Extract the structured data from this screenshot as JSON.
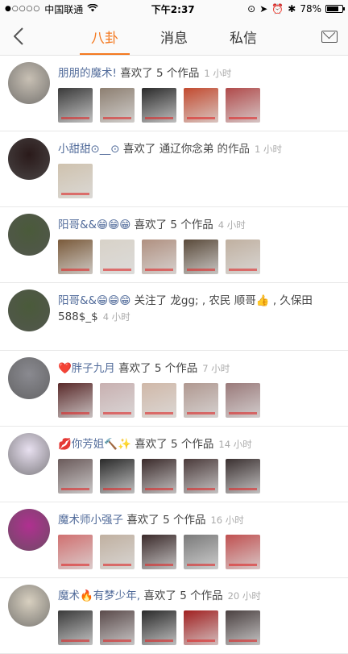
{
  "status": {
    "carrier": "中国联通",
    "signal": "●○○○○",
    "time": "下午2:37",
    "battery": "78%",
    "battery_level": 0.78
  },
  "nav": {
    "tabs": [
      {
        "label": "八卦",
        "active": true
      },
      {
        "label": "消息",
        "active": false
      },
      {
        "label": "私信",
        "active": false
      }
    ]
  },
  "feed": [
    {
      "name": "朋朋的魔术!",
      "action": "喜欢了 5 个作品",
      "target": "",
      "time": "1 小时",
      "thumb_count": 5,
      "avatar_color": "#c8c0b4",
      "thumb_colors": [
        "#3a3a3a",
        "#8d7f71",
        "#2a2a2a",
        "#c24a2f",
        "#b04a4a"
      ]
    },
    {
      "name": "小甜甜⊙__⊙",
      "action": "喜欢了",
      "target": "通辽你念弟",
      "target_suffix": "的作品",
      "time": "1 小时",
      "thumb_count": 1,
      "avatar_color": "#2a1a1a",
      "thumb_colors": [
        "#cfc2ae"
      ]
    },
    {
      "name": "阳哥&&😁😁😁",
      "action": "喜欢了 5 个作品",
      "target": "",
      "time": "4 小时",
      "thumb_count": 5,
      "avatar_color": "#4a5a3a",
      "thumb_colors": [
        "#7a5a3a",
        "#d8d2c8",
        "#b09080",
        "#5a4a3a",
        "#c0b0a0"
      ]
    },
    {
      "name": "阳哥&&😁😁😁",
      "action": "关注了",
      "target": "龙gg; , 农民 顺哥👍 , 久保田588$_$",
      "time": "4 小时",
      "thumb_count": 0,
      "avatar_color": "#4a5a3a",
      "thumb_colors": []
    },
    {
      "name": "❤️胖子九月",
      "action": "喜欢了 5 个作品",
      "target": "",
      "time": "7 小时",
      "thumb_count": 5,
      "avatar_color": "#8a8a90",
      "thumb_colors": [
        "#5a2a2a",
        "#c8b0b0",
        "#d0b8a8",
        "#b09890",
        "#9a7a7a"
      ]
    },
    {
      "name": "💋你芳姐🔨✨",
      "action": "喜欢了 5 个作品",
      "target": "",
      "time": "14 小时",
      "thumb_count": 5,
      "avatar_color": "#e8e0f0",
      "thumb_colors": [
        "#6a5a5a",
        "#2a2a2a",
        "#3a2a2a",
        "#4a3a3a",
        "#3a3030"
      ]
    },
    {
      "name": "魔术师小强子",
      "action": "喜欢了 5 个作品",
      "target": "",
      "time": "16 小时",
      "thumb_count": 5,
      "avatar_color": "#b03090",
      "thumb_colors": [
        "#d07070",
        "#c0b0a0",
        "#3a2a2a",
        "#7a7a7a",
        "#c05050"
      ]
    },
    {
      "name": "魔术🔥有梦少年,",
      "action": "喜欢了 5 个作品",
      "target": "",
      "time": "20 小时",
      "thumb_count": 5,
      "avatar_color": "#d8d0c0",
      "thumb_colors": [
        "#3a3a3a",
        "#5a4a4a",
        "#2a2a2a",
        "#a02020",
        "#4a4040"
      ]
    }
  ]
}
